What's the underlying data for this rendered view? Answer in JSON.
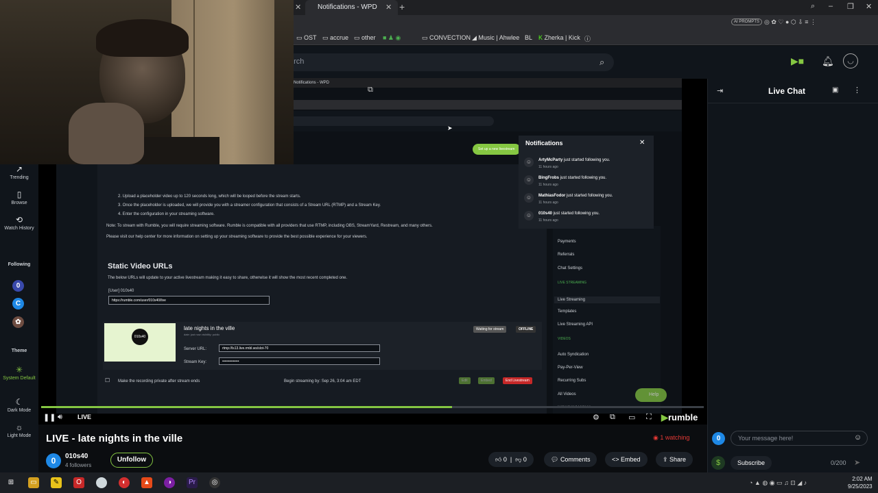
{
  "browser": {
    "tab_title": "Notifications - WPD",
    "ai_chip": "AI PROMPTS",
    "bookmarks": [
      "OST",
      "accrue",
      "other",
      "CONVECTION",
      "Music | Ahwlee",
      "Zherka | Kick"
    ]
  },
  "header": {
    "search_placeholder": "arch"
  },
  "sidebar": {
    "items": [
      {
        "label": "Trending",
        "icon": "trending-icon"
      },
      {
        "label": "Browse",
        "icon": "browse-icon"
      },
      {
        "label": "Watch History",
        "icon": "history-icon"
      }
    ],
    "following_label": "Following",
    "theme_label": "Theme",
    "theme_items": [
      "System Default",
      "Dark Mode",
      "Light Mode"
    ]
  },
  "embedded": {
    "tab_title": "Notifications - WPD",
    "steps": [
      "2. Upload a placeholder video up to 120 seconds long, which will be looped before the stream starts.",
      "3. Once the placeholder is uploaded, we will provide you with a streamer configuration that consists of a Stream URL (RTMP) and a Stream Key.",
      "4. Enter the configuration in your streaming software."
    ],
    "note": "Note: To stream with Rumble, you will require streaming software. Rumble is compatible with all providers that use RTMP, including OBS, StreamYard, Restream, and many others.",
    "visit": "Please visit our help center for more information on setting up your streaming software to provide the best possible experience for your viewers.",
    "static_title": "Static Video URLs",
    "static_desc": "The below URLs will update to your active livestream making it easy to share, otherwise it will show the most recent completed one.",
    "user_label": "[User] 010s40",
    "static_url": "https://rumble.com/user/010s40/live",
    "stream_title": "late nights in the ville",
    "stream_meta": "date: just now  visibility: public",
    "thumb_logo": "010s40",
    "server_label": "Server URL:",
    "server_value": "rtmp://ls13.live.rmbl.ws/slot-70",
    "key_label": "Stream Key:",
    "key_value": "••••••••••••••",
    "waiting": "Waiting for stream",
    "offline": "OFFLINE",
    "private_label": "Make the recording private after stream ends",
    "begin_by": "Begin streaming by: Sep 26, 3:04 am EDT",
    "end_btn": "End Livestream",
    "edit_btn": "Edit",
    "embed_btn": "Embed",
    "setup_btn": "Set up a new livestream",
    "notif_title": "Notifications",
    "notifications": [
      {
        "name": "ArtyMcParty",
        "text": " just started following you.",
        "time": "11 hours ago"
      },
      {
        "name": "BingFrobs",
        "text": " just started following you.",
        "time": "11 hours ago"
      },
      {
        "name": "MathiasFodor",
        "text": " just started following you.",
        "time": "11 hours ago"
      },
      {
        "name": "010s40",
        "text": " just started following you.",
        "time": "11 hours ago"
      }
    ],
    "right_menu": [
      "Payments",
      "Referrals",
      "Chat Settings",
      "Live Streaming",
      "Templates",
      "Live Streaming API",
      "Auto Syndication",
      "Pay-Per-View",
      "Recurring Subs",
      "All Videos",
      "Scheduled Videos"
    ],
    "right_sections": [
      "LIVE STREAMING",
      "VIDEOS"
    ],
    "help": "Help"
  },
  "player": {
    "live_label": "LIVE",
    "progress": 0.62,
    "brand": "rumble"
  },
  "video": {
    "title": "LIVE - late nights in the ville",
    "channel_initial": "0",
    "channel": "010s40",
    "followers": "4 followers",
    "unfollow": "Unfollow",
    "watching": "1 watching",
    "likes": "0",
    "dislikes": "0",
    "comments": "Comments",
    "embed": "Embed",
    "share": "Share"
  },
  "chat": {
    "title": "Live Chat",
    "placeholder": "Your message here!",
    "user_initial": "0",
    "subscribe": "Subscribe",
    "count": "0/200"
  },
  "taskbar": {
    "time": "2:02 AM",
    "date": "9/25/2023"
  },
  "colors": {
    "accent": "#85c742",
    "live_red": "#e53935",
    "bg": "#10151b"
  }
}
